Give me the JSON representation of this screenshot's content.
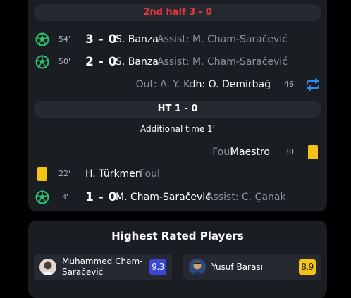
{
  "timeline": {
    "second_half_label": "2nd half 3 - 0",
    "halftime_label": "HT 1 - 0",
    "additional_time": "Additional time 1'",
    "events": [
      {
        "minute": "54'",
        "score": "3 - 0",
        "player": "S. Banza",
        "assist": "Assist: M. Cham-Saračević"
      },
      {
        "minute": "50'",
        "score": "2 - 0",
        "player": "S. Banza",
        "assist": "Assist: M. Cham-Saračević"
      },
      {
        "minute": "46'",
        "out_label": "Out: A. Y. Kol",
        "in_label": "In: O. Demirbağ"
      },
      {
        "minute": "30'",
        "reason": "Foul",
        "player": "Maestro"
      },
      {
        "minute": "22'",
        "reason": "Foul",
        "player": "H. Türkmen"
      },
      {
        "minute": "3'",
        "score": "1 - 0",
        "player": "M. Cham-Saračević",
        "assist": "Assist: C. Çanak"
      }
    ]
  },
  "ratings": {
    "title": "Highest Rated Players",
    "players": [
      {
        "name_line1": "Muhammed Cham-",
        "name_line2": "Saračević",
        "rating": "9.3",
        "rating_color": "#3b46d6"
      },
      {
        "name_line1": "Yusuf Barası",
        "rating": "8.9",
        "rating_color": "#f3c316"
      }
    ]
  },
  "colors": {
    "accent_red": "#e5383b",
    "goal_green": "#28c76f",
    "sub_blue": "#2f8cf0",
    "yellow_card": "#f3c316"
  }
}
